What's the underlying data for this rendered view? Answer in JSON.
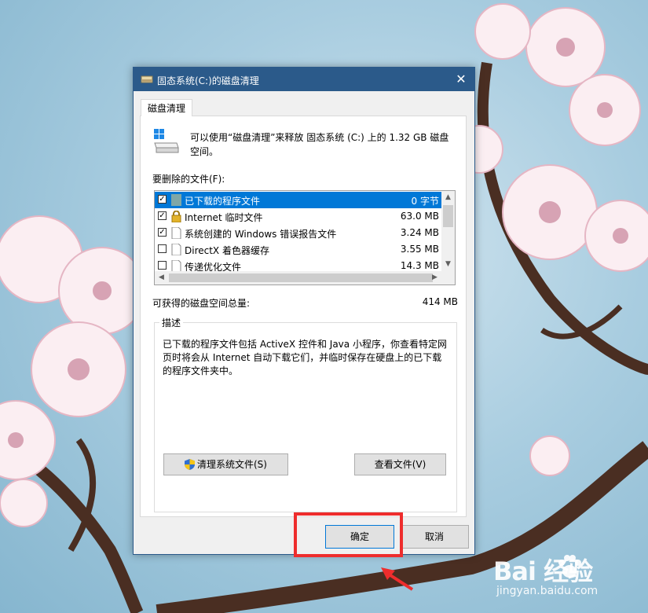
{
  "window": {
    "title": "固态系统(C:)的磁盘清理",
    "close_glyph": "✕"
  },
  "tab": {
    "label": "磁盘清理"
  },
  "intro": {
    "text": "可以使用“磁盘清理”来释放 固态系统 (C:) 上的 1.32 GB 磁盘空间。"
  },
  "files": {
    "label": "要删除的文件(F):",
    "items": [
      {
        "checked": true,
        "icon": "folder-icon",
        "name": "已下载的程序文件",
        "size": "0 字节",
        "selected": true
      },
      {
        "checked": true,
        "icon": "lock-icon",
        "name": "Internet 临时文件",
        "size": "63.0 MB",
        "selected": false
      },
      {
        "checked": true,
        "icon": "file-icon",
        "name": "系统创建的 Windows 错误报告文件",
        "size": "3.24 MB",
        "selected": false
      },
      {
        "checked": false,
        "icon": "file-icon",
        "name": "DirectX 着色器缓存",
        "size": "3.55 MB",
        "selected": false
      },
      {
        "checked": false,
        "icon": "file-icon",
        "name": "传递优化文件",
        "size": "14.3 MB",
        "selected": false
      }
    ]
  },
  "space": {
    "label": "可获得的磁盘空间总量:",
    "value": "414 MB"
  },
  "description": {
    "legend": "描述",
    "text": "已下载的程序文件包括 ActiveX 控件和 Java 小程序，你查看特定网页时将会从 Internet 自动下载它们，并临时保存在硬盘上的已下载的程序文件夹中。"
  },
  "buttons": {
    "clean_system": "清理系统文件(S)",
    "view_files": "查看文件(V)",
    "ok": "确定",
    "cancel": "取消"
  },
  "watermark": {
    "brand": "Bai  经验",
    "site": "jingyan.baidu.com"
  },
  "colors": {
    "titlebar": "#2b5a8a",
    "selection": "#0078d7",
    "highlight": "#ee2d2d"
  }
}
